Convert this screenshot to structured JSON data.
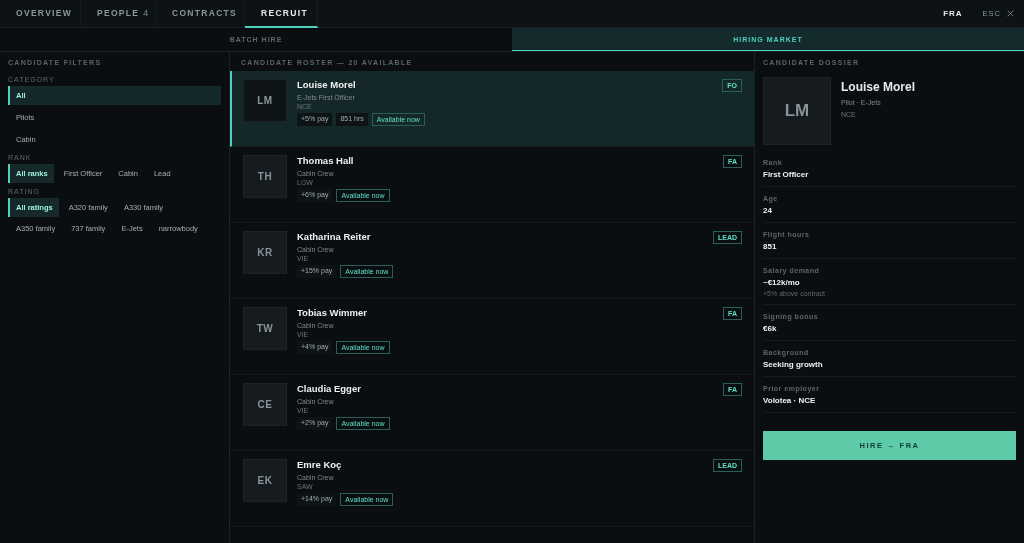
{
  "tabs": [
    {
      "label": "OVERVIEW",
      "selected": false
    },
    {
      "label": "PEOPLE",
      "count": "4",
      "selected": false
    },
    {
      "label": "CONTRACTS",
      "selected": false
    },
    {
      "label": "RECRUIT",
      "selected": true
    }
  ],
  "base": "FRA",
  "close": {
    "label": "ESC"
  },
  "subtabs": [
    {
      "label": "BATCH HIRE",
      "selected": false
    },
    {
      "label": "HIRING MARKET",
      "selected": true
    }
  ],
  "filters": {
    "title": "CANDIDATE FILTERS",
    "groups": [
      {
        "label": "CATEGORY",
        "kind": "list",
        "options": [
          {
            "label": "All",
            "selected": true
          },
          {
            "label": "Pilots",
            "selected": false
          },
          {
            "label": "Cabin",
            "selected": false
          }
        ]
      },
      {
        "label": "RANK",
        "kind": "chips",
        "options": [
          {
            "label": "All ranks",
            "selected": true
          },
          {
            "label": "First Officer",
            "selected": false
          },
          {
            "label": "Cabin",
            "selected": false
          },
          {
            "label": "Lead",
            "selected": false
          }
        ]
      },
      {
        "label": "RATING",
        "kind": "chips",
        "options": [
          {
            "label": "All ratings",
            "selected": true
          },
          {
            "label": "A320 family",
            "selected": false
          },
          {
            "label": "A330 family",
            "selected": false
          },
          {
            "label": "A350 family",
            "selected": false
          },
          {
            "label": "737 family",
            "selected": false
          },
          {
            "label": "E-Jets",
            "selected": false
          },
          {
            "label": "narrowbody",
            "selected": false
          }
        ]
      }
    ]
  },
  "roster": {
    "title": "CANDIDATE ROSTER — 20 AVAILABLE",
    "candidates": [
      {
        "initials": "LM",
        "name": "Louise Morel",
        "role": "E-Jets First Officer",
        "base": "NCE",
        "pay": "+5% pay",
        "hours": "851 hrs",
        "availability": "Available now",
        "badge": "FO",
        "selected": true
      },
      {
        "initials": "TH",
        "name": "Thomas Hall",
        "role": "Cabin Crew",
        "base": "LGW",
        "pay": "+6% pay",
        "availability": "Available now",
        "badge": "FA",
        "selected": false
      },
      {
        "initials": "KR",
        "name": "Katharina Reiter",
        "role": "Cabin Crew",
        "base": "VIE",
        "pay": "+15% pay",
        "availability": "Available now",
        "badge": "LEAD",
        "selected": false
      },
      {
        "initials": "TW",
        "name": "Tobias Wimmer",
        "role": "Cabin Crew",
        "base": "VIE",
        "pay": "+4% pay",
        "availability": "Available now",
        "badge": "FA",
        "selected": false
      },
      {
        "initials": "CE",
        "name": "Claudia Egger",
        "role": "Cabin Crew",
        "base": "VIE",
        "pay": "+2% pay",
        "availability": "Available now",
        "badge": "FA",
        "selected": false
      },
      {
        "initials": "EK",
        "name": "Emre Koç",
        "role": "Cabin Crew",
        "base": "SAW",
        "pay": "+14% pay",
        "availability": "Available now",
        "badge": "LEAD",
        "selected": false
      }
    ]
  },
  "dossier": {
    "title": "CANDIDATE DOSSIER",
    "initials": "LM",
    "name": "Louise Morel",
    "subtitle": "Pilot · E-Jets",
    "base": "NCE",
    "fields": [
      {
        "label": "Rank",
        "value": "First Officer"
      },
      {
        "label": "Age",
        "value": "24"
      },
      {
        "label": "Flight hours",
        "value": "851"
      },
      {
        "label": "Salary demand",
        "value": "~€12k/mo",
        "note": "+5% above contract"
      },
      {
        "label": "Signing bonus",
        "value": "€6k"
      },
      {
        "label": "Background",
        "value": "Seeking growth"
      },
      {
        "label": "Prior employer",
        "value": "Volotea · NCE"
      }
    ],
    "action": "HIRE → FRA"
  }
}
